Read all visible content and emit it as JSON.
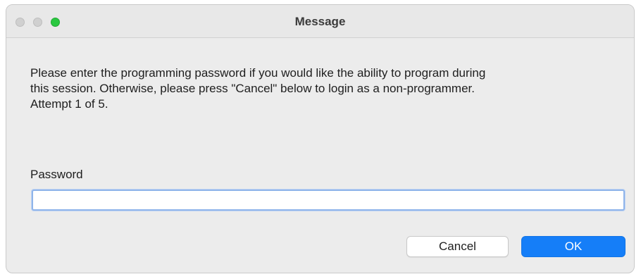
{
  "window": {
    "title": "Message"
  },
  "message": {
    "lines": [
      "Please enter the programming password if you would like the ability to program during",
      "this session. Otherwise, please press \"Cancel\" below to login as a non-programmer.",
      "Attempt 1 of 5."
    ]
  },
  "form": {
    "password_label": "Password",
    "password_value": ""
  },
  "buttons": {
    "cancel_label": "Cancel",
    "ok_label": "OK"
  },
  "colors": {
    "accent": "#157ef8",
    "zoom_light": "#2ac840"
  },
  "icons": {
    "close": "close-traffic-light-icon",
    "minimize": "minimize-traffic-light-icon",
    "zoom": "zoom-traffic-light-icon"
  }
}
